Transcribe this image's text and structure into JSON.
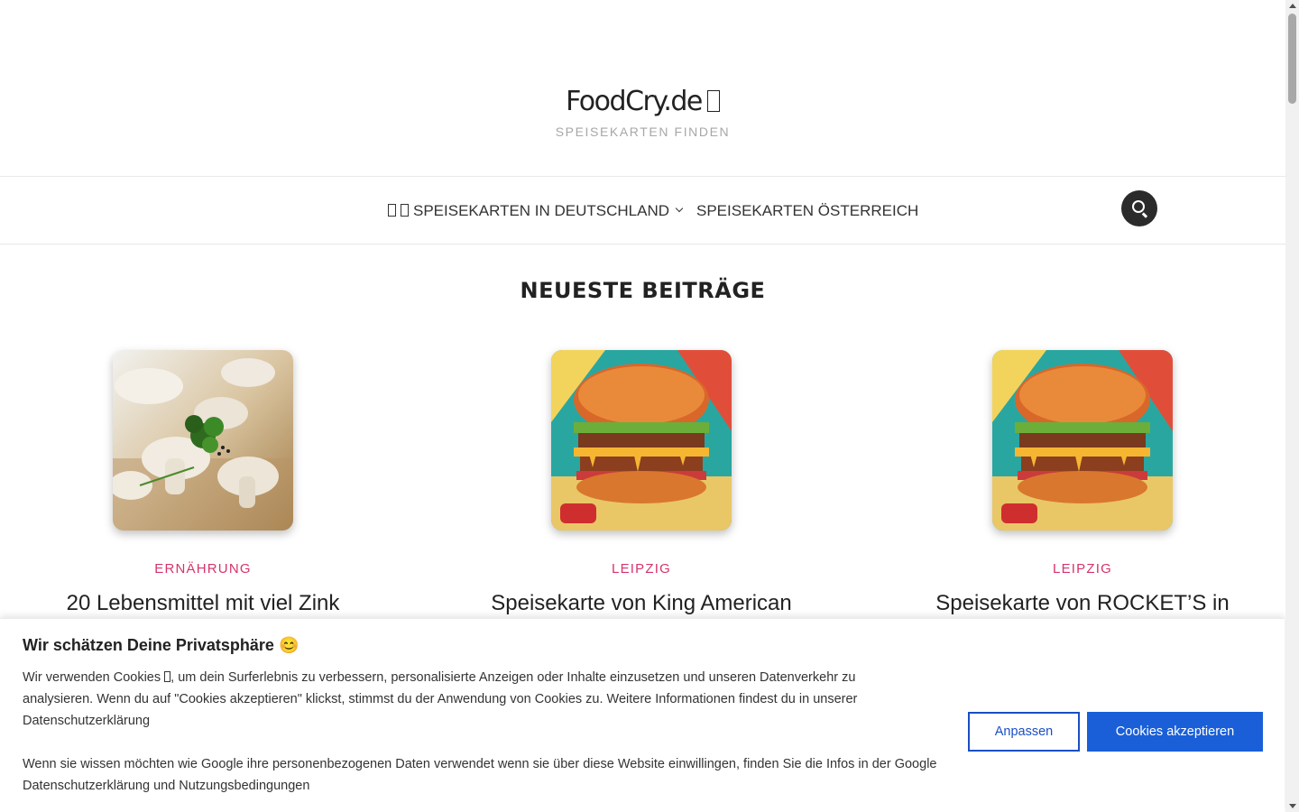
{
  "header": {
    "site_title": "FoodCry.de",
    "tagline": "Speisekarten finden"
  },
  "nav": {
    "items": [
      {
        "label": "Speisekarten in Deutschland"
      },
      {
        "label": "Speisekarten Österreich"
      }
    ],
    "search_icon": "search-icon"
  },
  "section": {
    "title": "Neueste Beiträge"
  },
  "posts": [
    {
      "category": "Ernährung",
      "title": "20 Lebensmittel mit viel Zink",
      "image": "mushrooms-photo"
    },
    {
      "category": "Leipzig",
      "title": "Speisekarte von King American",
      "image": "burger-illustration"
    },
    {
      "category": "Leipzig",
      "title": "Speisekarte von ROCKET’S in",
      "image": "burger-illustration"
    }
  ],
  "cookie_banner": {
    "title": "Wir schätzen Deine Privatsphäre 😊",
    "text_part1": "Wir verwenden Cookies ",
    "text_part2": ", um dein Surferlebnis zu verbessern, personalisierte Anzeigen oder Inhalte einzusetzen und unseren Datenverkehr zu analysieren. Wenn du auf \"Cookies akzeptieren\" klickst, stimmst du der Anwendung von Cookies zu. Weitere Informationen findest du in unserer ",
    "privacy_link": "Datenschutzerklärung",
    "google_text": "Wenn sie wissen möchten wie Google ihre personenbezogenen Daten verwendet wenn sie über diese Website einwillingen, finden Sie die Infos in der ",
    "google_link": "Google Datenschutzerklärung und Nutzungsbedingungen",
    "customize_label": "Anpassen",
    "accept_label": "Cookies akzeptieren"
  },
  "colors": {
    "category": "#d6336c",
    "primary_button": "#1a5fd8",
    "search_button": "#2b2b2b"
  }
}
